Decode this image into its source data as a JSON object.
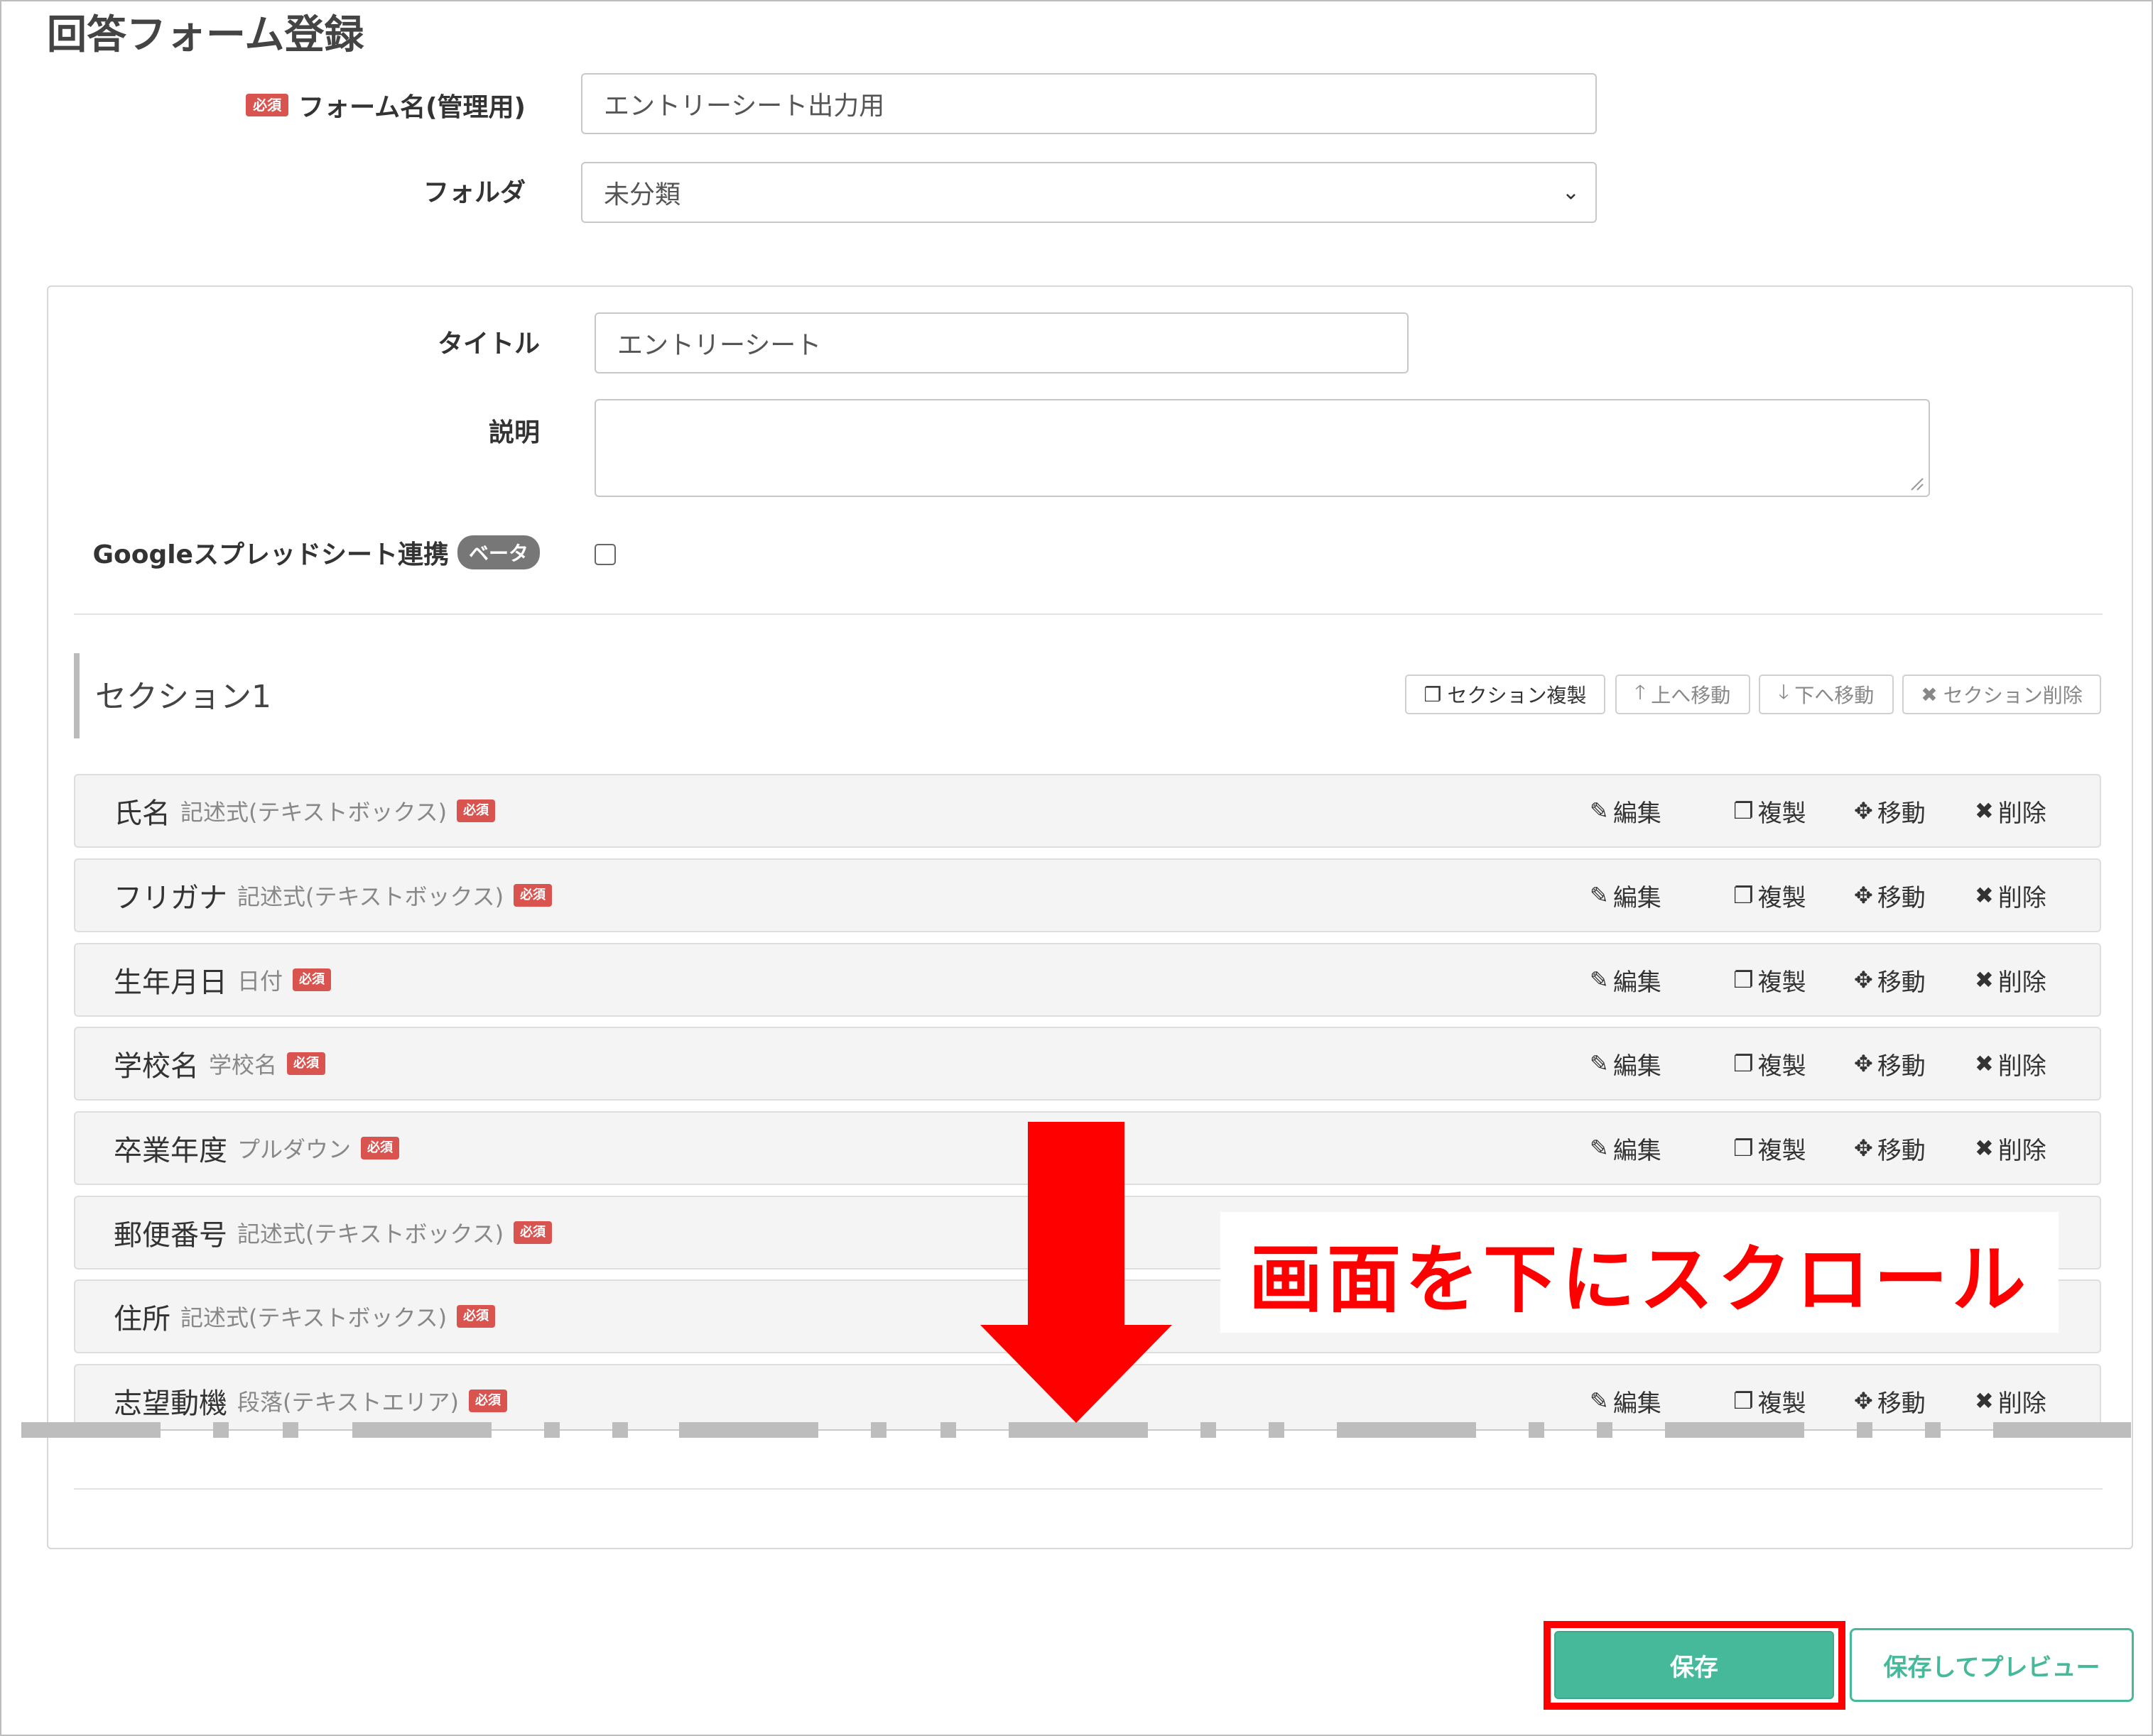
{
  "page": {
    "title": "回答フォーム登録"
  },
  "form": {
    "required_badge": "必須",
    "name_label": "フォーム名(管理用)",
    "name_value": "エントリーシート出力用",
    "folder_label": "フォルダ",
    "folder_value": "未分類"
  },
  "settings": {
    "title_label": "タイトル",
    "title_value": "エントリーシート",
    "description_label": "説明",
    "description_value": "",
    "sheets_label": "Googleスプレッドシート連携",
    "sheets_badge": "ベータ",
    "sheets_checked": false
  },
  "section": {
    "title": "セクション1",
    "buttons": [
      {
        "icon": "copy-icon",
        "label": "セクション複製"
      },
      {
        "icon": "arrow-up-icon",
        "label": "上へ移動"
      },
      {
        "icon": "arrow-down-icon",
        "label": "下へ移動"
      },
      {
        "icon": "close-icon",
        "label": "セクション削除"
      }
    ]
  },
  "actions": {
    "edit": "編集",
    "copy": "複製",
    "move": "移動",
    "delete": "削除"
  },
  "questions": [
    {
      "name": "氏名",
      "type": "記述式(テキストボックス)",
      "badge": "必須"
    },
    {
      "name": "フリガナ",
      "type": "記述式(テキストボックス)",
      "badge": "必須"
    },
    {
      "name": "生年月日",
      "type": "日付",
      "badge": "必須"
    },
    {
      "name": "学校名",
      "type": "学校名",
      "badge": "必須"
    },
    {
      "name": "卒業年度",
      "type": "プルダウン",
      "badge": "必須"
    },
    {
      "name": "郵便番号",
      "type": "記述式(テキストボックス)",
      "badge": "必須"
    },
    {
      "name": "住所",
      "type": "記述式(テキストボックス)",
      "badge": "必須"
    },
    {
      "name": "志望動機",
      "type": "段落(テキストエリア)",
      "badge": "必須"
    }
  ],
  "annotation": {
    "callout": "画面を下にスクロール",
    "color": "#ff0000"
  },
  "footer": {
    "save_label": "保存",
    "preview_label": "保存してプレビュー",
    "accent": "#46b99b"
  }
}
